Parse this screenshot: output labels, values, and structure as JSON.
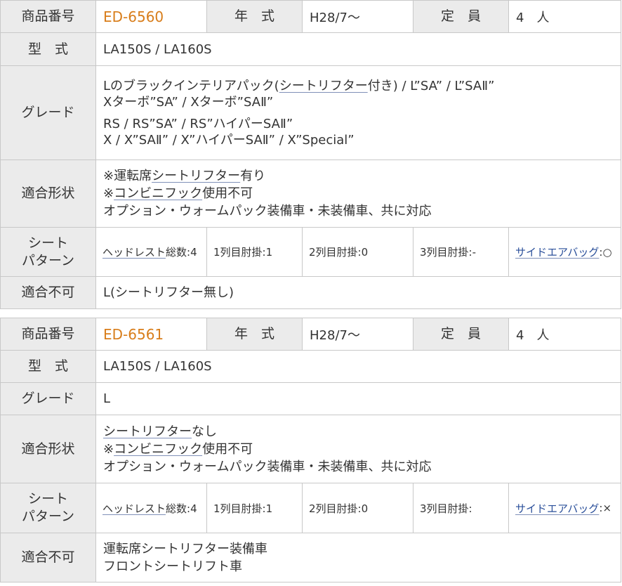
{
  "products": [
    {
      "code_label": "商品番号",
      "code": "ED-6560",
      "year_label": "年　式",
      "year": "H28/7〜",
      "capacity_label": "定　員",
      "capacity": "4　人",
      "model_label": "型　式",
      "model": "LA150S / LA160S",
      "grade_label": "グレード",
      "grade_lines": [
        [
          "Lのブラックインテリアパック(",
          "シートリフター",
          "付き) / L”SA” / L”SAⅡ”"
        ],
        [
          "Xターボ”SA” / Xターボ”SAⅡ”"
        ],
        [
          "RS / RS”SA” / RS”ハイパーSAⅡ”"
        ],
        [
          "X / X”SAⅡ” / X”ハイパーSAⅡ” / X”Special”"
        ]
      ],
      "fit_label": "適合形状",
      "fit_lines": [
        [
          "※運転席",
          "シートリフター",
          "有り"
        ],
        [
          "※",
          "コンビニフック",
          "使用不可"
        ],
        [
          "オプション・ウォームパック装備車・未装備車、共に対応"
        ]
      ],
      "pattern_label": "シート\nパターン",
      "pattern": {
        "headrest_link": "ヘッドレスト",
        "headrest_text": "総数:4",
        "row1": "1列目肘掛:1",
        "row2": "2列目肘掛:0",
        "row3": "3列目肘掛:-",
        "airbag_link": "サイドエアバッグ",
        "airbag_text": ":○"
      },
      "ng_label": "適合不可",
      "ng_lines": [
        "L(シートリフター無し)"
      ]
    },
    {
      "code_label": "商品番号",
      "code": "ED-6561",
      "year_label": "年　式",
      "year": "H28/7〜",
      "capacity_label": "定　員",
      "capacity": "4　人",
      "model_label": "型　式",
      "model": "LA150S / LA160S",
      "grade_label": "グレード",
      "grade_lines": [
        [
          "L"
        ]
      ],
      "fit_label": "適合形状",
      "fit_lines": [
        [
          "",
          "シートリフター",
          "なし"
        ],
        [
          "※",
          "コンビニフック",
          "使用不可"
        ],
        [
          "オプション・ウォームパック装備車・未装備車、共に対応"
        ]
      ],
      "pattern_label": "シート\nパターン",
      "pattern": {
        "headrest_link": "ヘッドレスト",
        "headrest_text": "総数:4",
        "row1": "1列目肘掛:1",
        "row2": "2列目肘掛:0",
        "row3": "3列目肘掛:",
        "airbag_link": "サイドエアバッグ",
        "airbag_text": ":×"
      },
      "ng_label": "適合不可",
      "ng_lines": [
        "運転席シートリフター装備車",
        "フロントシートリフト車"
      ]
    }
  ]
}
